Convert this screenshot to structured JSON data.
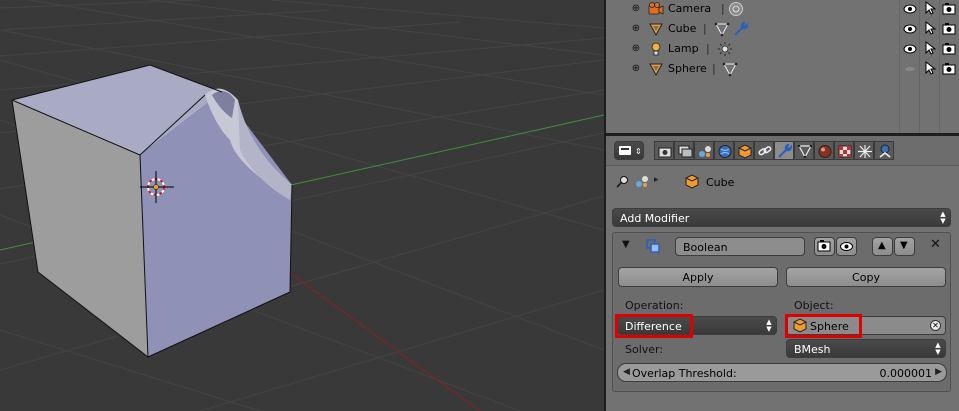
{
  "viewport": {
    "description_icons": [
      "3d-cursor-icon",
      "object-origin-icon"
    ]
  },
  "outliner": {
    "items": [
      {
        "label": "Camera",
        "icon": "camera-object-icon",
        "sub": "camera-data-icon"
      },
      {
        "label": "Cube",
        "icon": "mesh-object-icon",
        "sub": "mesh-data-icon",
        "sub2": "wrench-modifier-icon"
      },
      {
        "label": "Lamp",
        "icon": "lamp-object-icon",
        "sub": "lamp-data-icon"
      },
      {
        "label": "Sphere",
        "icon": "mesh-object-icon",
        "sub": "mesh-data-icon"
      }
    ]
  },
  "properties": {
    "context": {
      "object_name": "Cube"
    },
    "add_modifier_label": "Add Modifier",
    "modifier": {
      "name": "Boolean",
      "apply_label": "Apply",
      "copy_label": "Copy",
      "operation_label": "Operation:",
      "operation_value": "Difference",
      "object_label": "Object:",
      "object_value": "Sphere",
      "solver_label": "Solver:",
      "solver_value": "BMesh",
      "overlap_label": "Overlap Threshold:",
      "overlap_value": "0.000001"
    }
  },
  "colors": {
    "highlight": "#e00000",
    "viewport_bg": "#393939",
    "panel_bg": "#727272",
    "active_tab": "#8c8c8c"
  }
}
